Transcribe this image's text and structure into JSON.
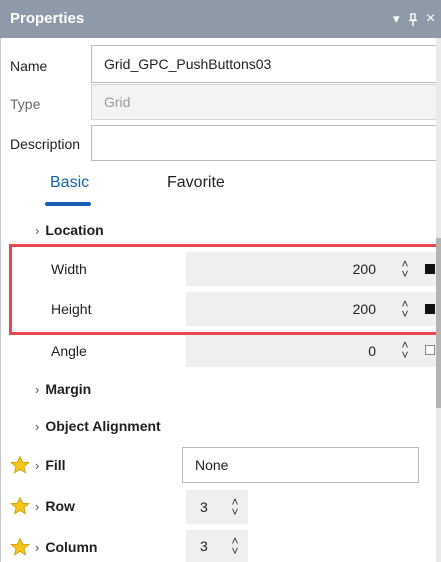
{
  "panel": {
    "title": "Properties",
    "pin_glyph": "▾ &#x1F4CC;",
    "dropdown_glyph": "▾",
    "pin_icon_glyph": "p",
    "close_glyph": "×"
  },
  "fields": {
    "name_label": "Name",
    "name_value": "Grid_GPC_PushButtons03",
    "type_label": "Type",
    "type_value": "Grid",
    "description_label": "Description",
    "description_value": ""
  },
  "tabs": {
    "basic": "Basic",
    "favorite": "Favorite"
  },
  "sections": {
    "location": "Location",
    "margin": "Margin",
    "object_alignment": "Object Alignment",
    "fill": "Fill",
    "row": "Row",
    "column": "Column"
  },
  "location": {
    "width_label": "Width",
    "width_value": "200",
    "height_label": "Height",
    "height_value": "200",
    "angle_label": "Angle",
    "angle_value": "0"
  },
  "fill": {
    "value": "None"
  },
  "row": {
    "value": "3"
  },
  "column": {
    "value": "3"
  },
  "glyphs": {
    "chevron_right": "›",
    "spin_up": "˄",
    "spin_down": "˅"
  },
  "colors": {
    "accent": "#1a5fb4",
    "highlight": "#e8474f",
    "titlebar": "#8f9aa8",
    "star": "#f5c518"
  }
}
